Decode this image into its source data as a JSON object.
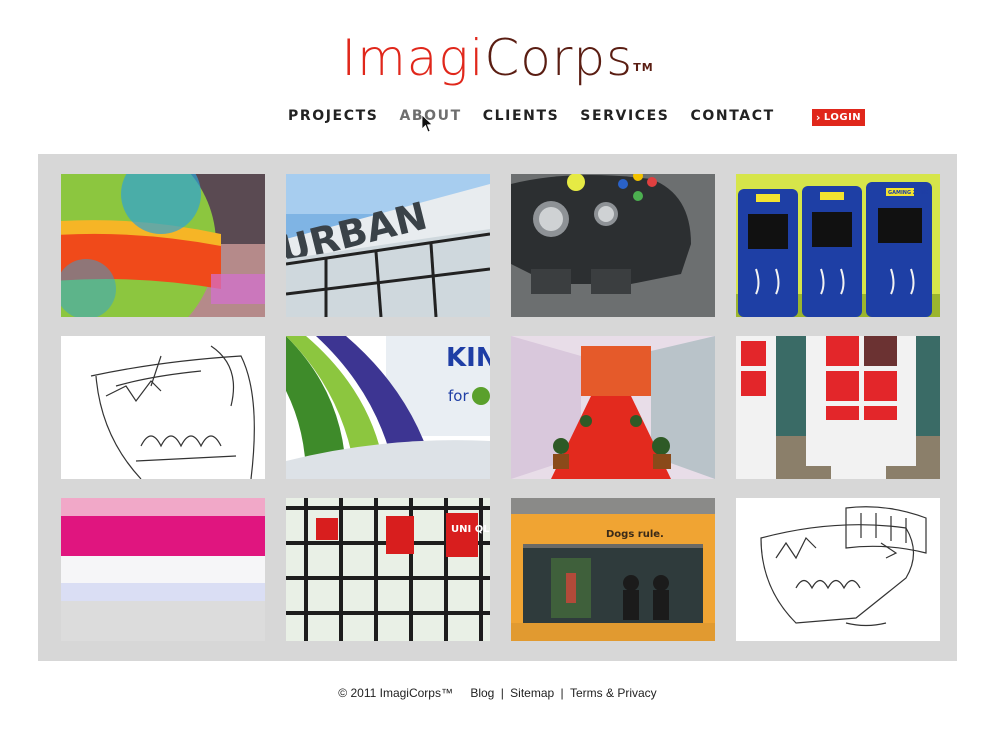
{
  "logo": {
    "part1": "Imagi",
    "part2": "Corps",
    "tm": "TM"
  },
  "nav": {
    "items": [
      {
        "label": "PROJECTS"
      },
      {
        "label": "ABOUT"
      },
      {
        "label": "CLIENTS"
      },
      {
        "label": "SERVICES"
      },
      {
        "label": "CONTACT"
      }
    ],
    "active_index": 1
  },
  "login": {
    "label": "LOGIN",
    "icon": "chevron-right-icon"
  },
  "gallery": {
    "tiles": [
      {
        "subject": "globe-display",
        "text": ""
      },
      {
        "subject": "urban-sign",
        "text": "URBAN"
      },
      {
        "subject": "game-controller",
        "text": ""
      },
      {
        "subject": "gaming-zone-kiosks",
        "text": "GAMING ZONE"
      },
      {
        "subject": "kiosk-sketch",
        "text": ""
      },
      {
        "subject": "kinect-banner",
        "text": "KIN",
        "text2": "for"
      },
      {
        "subject": "red-carpet-hallway",
        "text": ""
      },
      {
        "subject": "windows-phone-kiosks",
        "text": ""
      },
      {
        "subject": "pink-counter",
        "text": ""
      },
      {
        "subject": "uniqlo-store",
        "text": "UNI QLO"
      },
      {
        "subject": "dogs-rule-booth",
        "text": "Dogs rule."
      },
      {
        "subject": "zune-kiosk-sketch",
        "text": ""
      }
    ]
  },
  "footer": {
    "copyright": "© 2011 ImagiCorps™",
    "links": [
      "Blog",
      "Sitemap",
      "Terms & Privacy"
    ],
    "separator": "|"
  },
  "colors": {
    "brand_red": "#e0271b",
    "brand_brown": "#5a1d12",
    "gallery_bg": "#d7d7d7",
    "nav_active": "#6e6e6e"
  }
}
